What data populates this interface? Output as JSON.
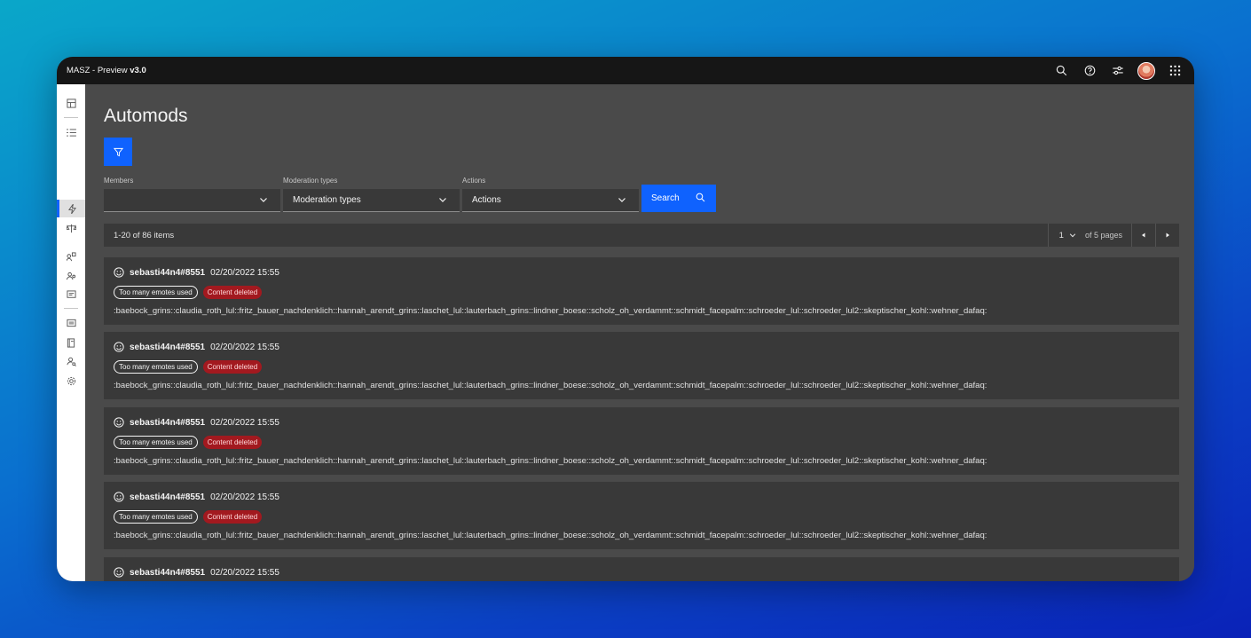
{
  "header": {
    "app_name": "MASZ - Preview ",
    "version": "v3.0"
  },
  "page": {
    "title": "Automods"
  },
  "filters": {
    "members_label": "Members",
    "members_value": "",
    "moderation_label": "Moderation types",
    "moderation_value": "Moderation types",
    "actions_label": "Actions",
    "actions_value": "Actions",
    "search_label": "Search"
  },
  "pagination": {
    "items": "1-20 of 86 items",
    "page": "1",
    "of_pages": "of 5 pages"
  },
  "entries": [
    {
      "user": "sebasti44n4#8551",
      "time": "02/20/2022 15:55",
      "type": "Too many emotes used",
      "action": "Content deleted",
      "content": ":baebock_grins::claudia_roth_lul::fritz_bauer_nachdenklich::hannah_arendt_grins::laschet_lul::lauterbach_grins::lindner_boese::scholz_oh_verdammt::schmidt_facepalm::schroeder_lul::schroeder_lul2::skeptischer_kohl::wehner_dafaq:"
    },
    {
      "user": "sebasti44n4#8551",
      "time": "02/20/2022 15:55",
      "type": "Too many emotes used",
      "action": "Content deleted",
      "content": ":baebock_grins::claudia_roth_lul::fritz_bauer_nachdenklich::hannah_arendt_grins::laschet_lul::lauterbach_grins::lindner_boese::scholz_oh_verdammt::schmidt_facepalm::schroeder_lul::schroeder_lul2::skeptischer_kohl::wehner_dafaq:"
    },
    {
      "user": "sebasti44n4#8551",
      "time": "02/20/2022 15:55",
      "type": "Too many emotes used",
      "action": "Content deleted",
      "content": ":baebock_grins::claudia_roth_lul::fritz_bauer_nachdenklich::hannah_arendt_grins::laschet_lul::lauterbach_grins::lindner_boese::scholz_oh_verdammt::schmidt_facepalm::schroeder_lul::schroeder_lul2::skeptischer_kohl::wehner_dafaq:"
    },
    {
      "user": "sebasti44n4#8551",
      "time": "02/20/2022 15:55",
      "type": "Too many emotes used",
      "action": "Content deleted",
      "content": ":baebock_grins::claudia_roth_lul::fritz_bauer_nachdenklich::hannah_arendt_grins::laschet_lul::lauterbach_grins::lindner_boese::scholz_oh_verdammt::schmidt_facepalm::schroeder_lul::schroeder_lul2::skeptischer_kohl::wehner_dafaq:"
    },
    {
      "user": "sebasti44n4#8551",
      "time": "02/20/2022 15:55"
    }
  ],
  "colors": {
    "accent": "#0f62fe",
    "danger_tag": "#a2191f",
    "shell": "#161616"
  },
  "icons": [
    "search-icon",
    "help-icon",
    "settings-sliders-icon",
    "user-avatar",
    "app-switcher-icon",
    "filter-icon",
    "chevron-down-icon",
    "face-icon"
  ]
}
